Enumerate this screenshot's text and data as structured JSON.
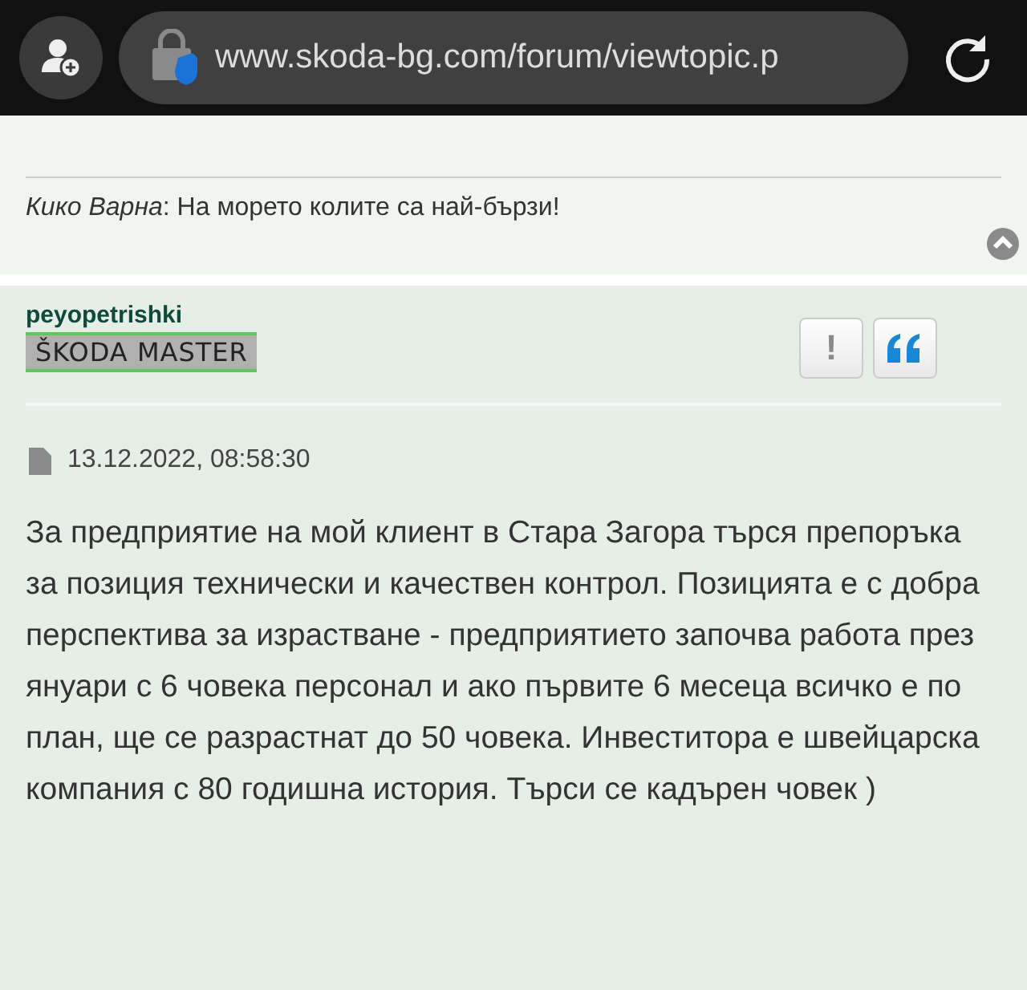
{
  "browser_bar": {
    "url": "www.skoda-bg.com/forum/viewtopic.p"
  },
  "previous_post": {
    "quote_author": "Кико Варна",
    "quote_text": ": На морето колите са най-бързи!"
  },
  "post": {
    "author": "peyopetrishki",
    "rank": "ŠKODA MASTER",
    "buttons": [
      {
        "kind": "report",
        "label": "!"
      },
      {
        "kind": "quote"
      }
    ],
    "date": "13.12.2022, 08:58:30",
    "body": "За предприятие на мой клиент в Стара Загора търся препоръка за позиция технически и качествен контрол. Позицията е с добра перспектива за израстване - предприятието започва работа през януари с 6 човека персонал и ако първите 6 месеца всичко е по план, ще се разрастнат до 50 човека. Инвеститора е швейцарска компания с 80 годишна история. Търси се кадърен човек )"
  }
}
